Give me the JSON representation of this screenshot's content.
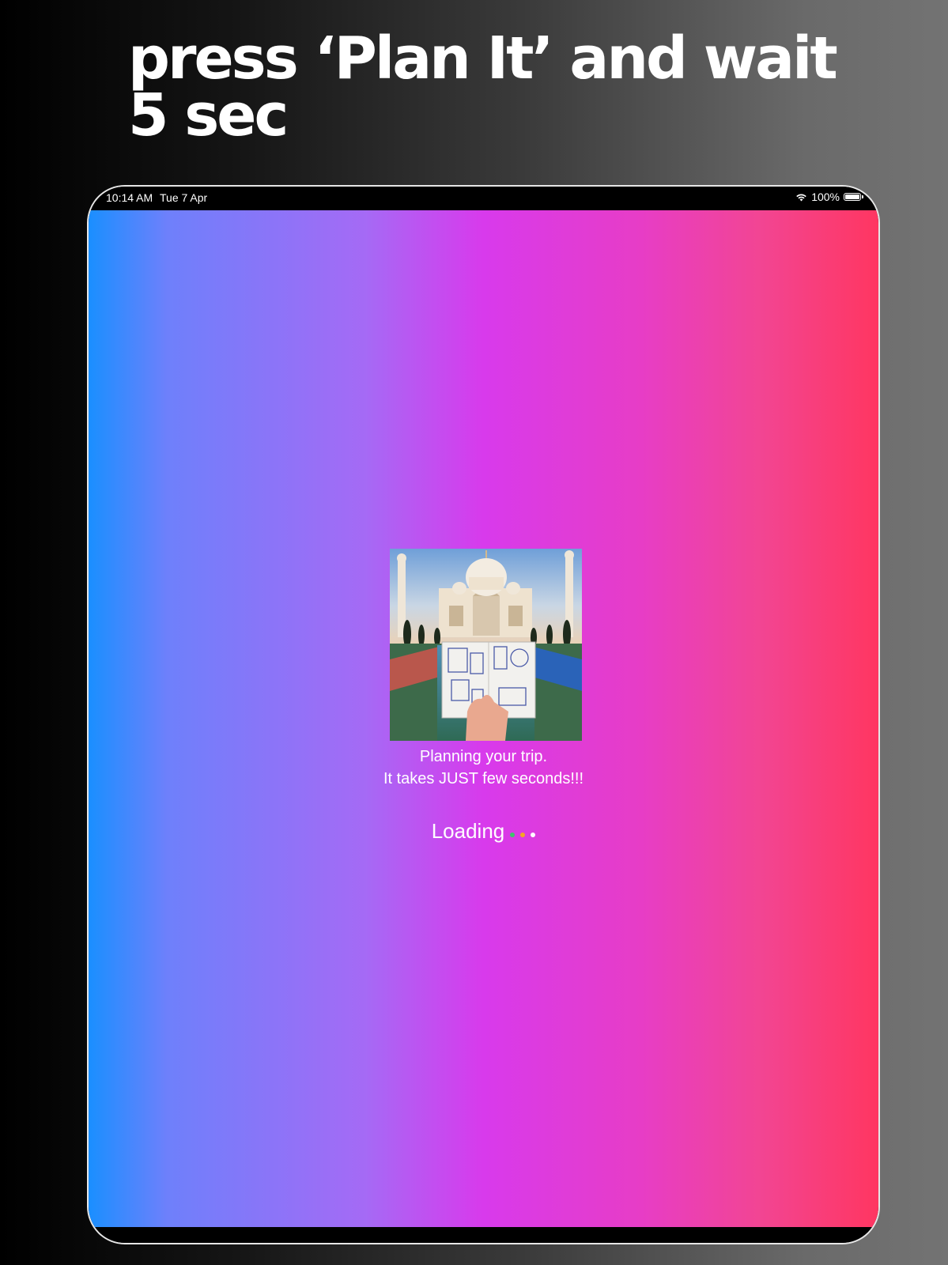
{
  "headline": "press ‘Plan It’ and wait 5 sec",
  "status_bar": {
    "time": "10:14 AM",
    "date": "Tue 7 Apr",
    "battery": "100%",
    "wifi_icon": "wifi-icon",
    "battery_icon": "battery-icon",
    "battery_level": 1.0
  },
  "loading_screen": {
    "image_icon": "taj-mahal-passport-photo",
    "caption_line1": "Planning your trip.",
    "caption_line2": "It takes JUST few seconds!!!",
    "loading_label": "Loading",
    "dot_colors": [
      "#3fc46b",
      "#f5a623",
      "#ffffff"
    ]
  },
  "colors": {
    "screen_gradient": [
      "#1a8fff",
      "#d83aec",
      "#ff3661"
    ],
    "page_background": [
      "#000000",
      "#737373"
    ]
  }
}
